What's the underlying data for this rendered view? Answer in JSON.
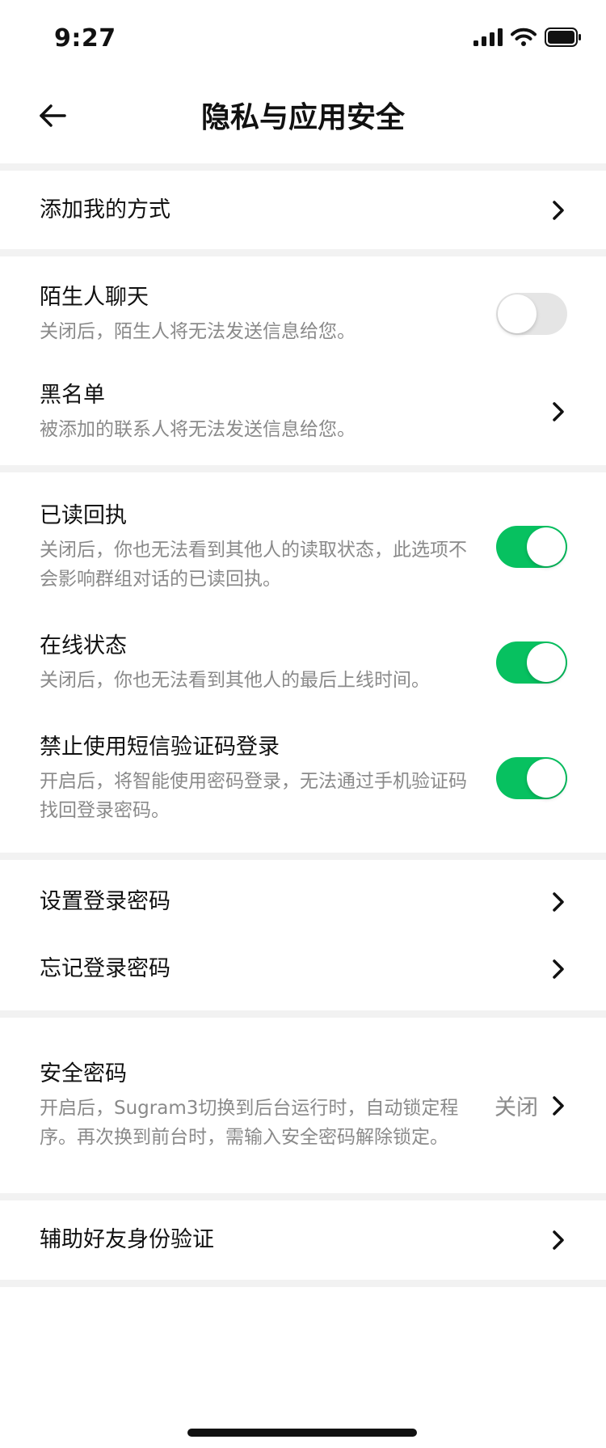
{
  "status_bar": {
    "time": "9:27",
    "icons": [
      "signal-icon",
      "wifi-icon",
      "battery-icon"
    ]
  },
  "nav": {
    "title": "隐私与应用安全",
    "back_icon": "back-arrow-icon"
  },
  "items": {
    "add_me": {
      "title": "添加我的方式"
    },
    "stranger_chat": {
      "title": "陌生人聊天",
      "desc": "关闭后，陌生人将无法发送信息给您。",
      "enabled": false
    },
    "blacklist": {
      "title": "黑名单",
      "desc": "被添加的联系人将无法发送信息给您。"
    },
    "read_receipt": {
      "title": "已读回执",
      "desc": "关闭后，你也无法看到其他人的读取状态，此选项不会影响群组对话的已读回执。",
      "enabled": true
    },
    "online_status": {
      "title": "在线状态",
      "desc": "关闭后，你也无法看到其他人的最后上线时间。",
      "enabled": true
    },
    "disable_sms_login": {
      "title": "禁止使用短信验证码登录",
      "desc": "开启后，将智能使用密码登录，无法通过手机验证码找回登录密码。",
      "enabled": true
    },
    "set_password": {
      "title": "设置登录密码"
    },
    "forgot_password": {
      "title": "忘记登录密码"
    },
    "security_code": {
      "title": "安全密码",
      "desc": "开启后，Sugram3切换到后台运行时，自动锁定程序。再次换到前台时，需输入安全密码解除锁定。",
      "value": "关闭"
    },
    "friend_verify": {
      "title": "辅助好友身份验证"
    }
  },
  "colors": {
    "accent": "#07c160",
    "toggle_off": "#e5e5e5",
    "section_gap": "#f2f2f2",
    "secondary_text": "#8a8a8a"
  }
}
